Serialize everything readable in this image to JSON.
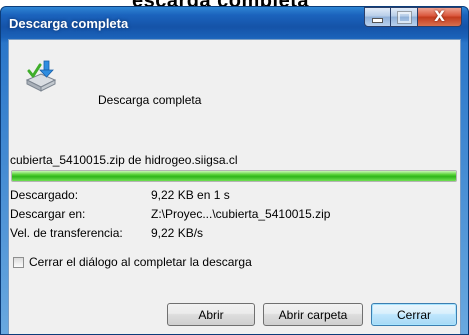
{
  "background": {
    "partial_text": "escarga completa"
  },
  "window": {
    "title": "Descarga completa",
    "caption": {
      "minimize_icon": "minimize-icon",
      "maximize_icon": "maximize-icon",
      "close_icon": "close-icon",
      "close_glyph": "X"
    }
  },
  "header": {
    "icon": "download-complete-icon",
    "text": "Descarga completa"
  },
  "download": {
    "source": "cubierta_5410015.zip de hidrogeo.siigsa.cl",
    "progress": 1.0,
    "progress_color": "#2fb51a",
    "details": [
      {
        "label": "Descargado:",
        "value": "9,22 KB en 1 s"
      },
      {
        "label": "Descargar en:",
        "value": "Z:\\Proyec...\\cubierta_5410015.zip"
      },
      {
        "label": "Vel. de transferencia:",
        "value": "9,22 KB/s"
      }
    ]
  },
  "option": {
    "checked": false,
    "label": "Cerrar el diálogo al completar la descarga"
  },
  "buttons": {
    "open": "Abrir",
    "open_folder": "Abrir carpeta",
    "close": "Cerrar"
  },
  "colors": {
    "titlebar": "#1553a8",
    "client_bg": "#f0f0f0",
    "close_button": "#c33a1c"
  }
}
